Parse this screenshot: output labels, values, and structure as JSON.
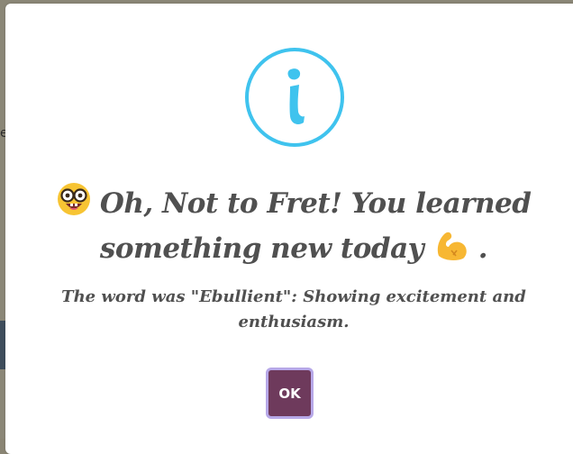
{
  "backdrop": {
    "glyph": "e"
  },
  "dialog": {
    "icon": "info-icon",
    "title_part1": "Oh, Not to Fret! You learned something new today",
    "title_part2": ".",
    "message": "The word was \"Ebullient\": Showing excitement and enthusiasm.",
    "ok_label": "OK"
  },
  "colors": {
    "accent": "#3fc3ee",
    "button_bg": "#6e3a5c",
    "button_border": "#b7a8e8",
    "text": "#505050"
  }
}
